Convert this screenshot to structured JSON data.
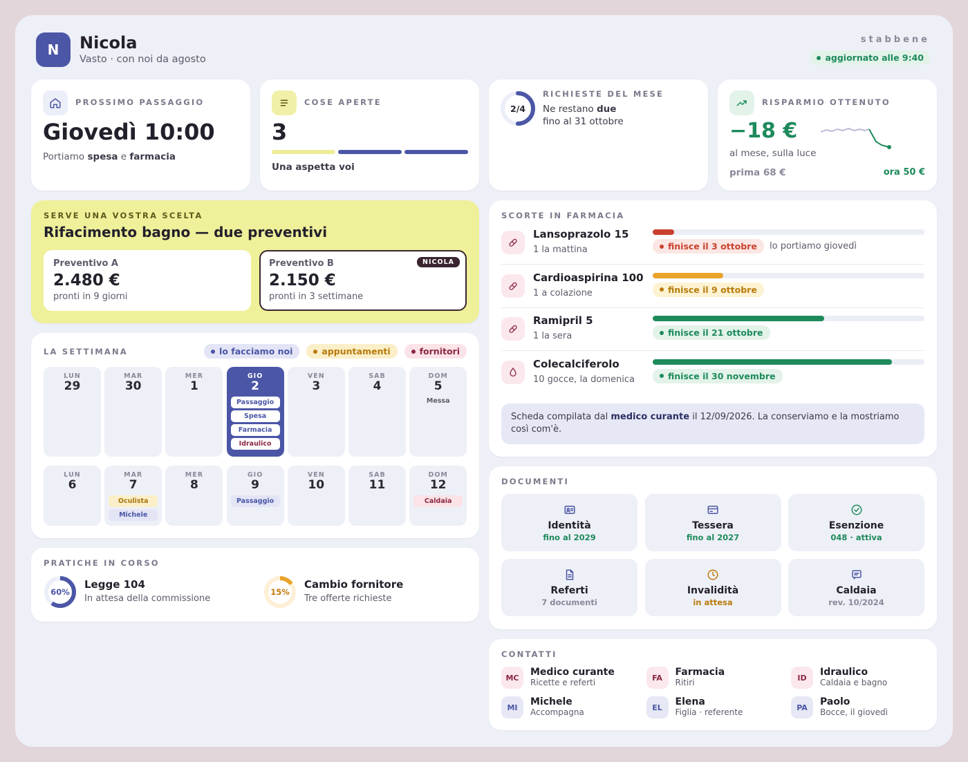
{
  "header": {
    "avatar_letter": "N",
    "name": "Nicola",
    "subtitle": "Vasto · con noi da agosto",
    "brand": "stabbene",
    "updated": "aggiornato alle 9:40"
  },
  "next_visit": {
    "label": "PROSSIMO PASSAGGIO",
    "time": "Giovedì 10:00",
    "desc_pre": "Portiamo ",
    "desc_b1": "spesa",
    "desc_mid": " e ",
    "desc_b2": "farmacia"
  },
  "open_items": {
    "label": "COSE APERTE",
    "count": "3",
    "note": "Una aspetta voi"
  },
  "requests": {
    "label": "RICHIESTE DEL MESE",
    "ring": "2/4",
    "ring_fraction": 0.5,
    "line1_pre": "Ne restano ",
    "line1_b": "due",
    "line2": "fino al 31 ottobre"
  },
  "savings": {
    "label": "RISPARMIO OTTENUTO",
    "value": "−18 €",
    "desc": "al mese, sulla luce",
    "before": "prima 68 €",
    "now": "ora 50 €"
  },
  "decision": {
    "label": "SERVE UNA VOSTRA SCELTA",
    "title": "Rifacimento bagno — due preventivi",
    "option_a": {
      "name": "Preventivo A",
      "price": "2.480 €",
      "time": "pronti in 9 giorni"
    },
    "option_b": {
      "name": "Preventivo B",
      "price": "2.150 €",
      "time": "pronti in 3 settimane",
      "badge": "NICOLA"
    }
  },
  "week": {
    "label": "LA SETTIMANA",
    "legend": [
      "lo facciamo noi",
      "appuntamenti",
      "fornitori"
    ],
    "row1": [
      {
        "dn": "LUN",
        "dd": "29",
        "events": []
      },
      {
        "dn": "MAR",
        "dd": "30",
        "events": []
      },
      {
        "dn": "MER",
        "dd": "1",
        "events": []
      },
      {
        "dn": "GIO",
        "dd": "2",
        "events": [
          "Passaggio",
          "Spesa",
          "Farmacia",
          "Idraulico"
        ]
      },
      {
        "dn": "VEN",
        "dd": "3",
        "events": []
      },
      {
        "dn": "SAB",
        "dd": "4",
        "events": []
      },
      {
        "dn": "DOM",
        "dd": "5",
        "events": [
          "Messa"
        ]
      }
    ],
    "row2": [
      {
        "dn": "LUN",
        "dd": "6",
        "events": []
      },
      {
        "dn": "MAR",
        "dd": "7",
        "events": [
          "Oculista",
          "Michele"
        ]
      },
      {
        "dn": "MER",
        "dd": "8",
        "events": []
      },
      {
        "dn": "GIO",
        "dd": "9",
        "events": [
          "Passaggio"
        ]
      },
      {
        "dn": "VEN",
        "dd": "10",
        "events": []
      },
      {
        "dn": "SAB",
        "dd": "11",
        "events": []
      },
      {
        "dn": "DOM",
        "dd": "12",
        "events": [
          "Caldaia"
        ]
      }
    ]
  },
  "practices": {
    "label": "PRATICHE IN CORSO",
    "items": [
      {
        "pct": "60%",
        "fraction": 0.6,
        "title": "Legge 104",
        "sub": "In attesa della commissione",
        "color": "#4b56a6"
      },
      {
        "pct": "15%",
        "fraction": 0.15,
        "title": "Cambio fornitore",
        "sub": "Tre offerte richieste",
        "color": "#e9a22a"
      }
    ]
  },
  "pharmacy": {
    "label": "SCORTE IN FARMACIA",
    "meds": [
      {
        "name": "Lansoprazolo 15",
        "dose": "1 la mattina",
        "level": 0.08,
        "tag": "finisce il 3 ottobre",
        "note": "lo portiamo giovedì",
        "color": "#c9412d"
      },
      {
        "name": "Cardioaspirina 100",
        "dose": "1 a colazione",
        "level": 0.26,
        "tag": "finisce il 9 ottobre",
        "note": "",
        "color": "#e9a22a"
      },
      {
        "name": "Ramipril 5",
        "dose": "1 la sera",
        "level": 0.63,
        "tag": "finisce il 21 ottobre",
        "note": "",
        "color": "#1e8a5c"
      },
      {
        "name": "Colecalciferolo",
        "dose": "10 gocce, la domenica",
        "level": 0.88,
        "tag": "finisce il 30 novembre",
        "note": "",
        "color": "#1e8a5c"
      }
    ],
    "footer_pre": "Scheda compilata dal ",
    "footer_b": "medico curante",
    "footer_post": " il 12/09/2026. La conserviamo e la mostriamo così com'è."
  },
  "documents": {
    "label": "DOCUMENTI",
    "items": [
      {
        "title": "Identità",
        "sub": "fino al 2029",
        "icon": "id-card-icon"
      },
      {
        "title": "Tessera",
        "sub": "fino al 2027",
        "icon": "card-icon"
      },
      {
        "title": "Esenzione",
        "sub": "048 · attiva",
        "icon": "check-circle-icon"
      },
      {
        "title": "Referti",
        "sub": "7 documenti",
        "icon": "file-icon"
      },
      {
        "title": "Invalidità",
        "sub": "in attesa",
        "icon": "clock-icon"
      },
      {
        "title": "Caldaia",
        "sub": "rev. 10/2024",
        "icon": "message-icon"
      }
    ]
  },
  "contacts": {
    "label": "CONTATTI",
    "items": [
      {
        "initials": "MC",
        "name": "Medico curante",
        "sub": "Ricette e referti"
      },
      {
        "initials": "FA",
        "name": "Farmacia",
        "sub": "Ritiri"
      },
      {
        "initials": "ID",
        "name": "Idraulico",
        "sub": "Caldaia e bagno"
      },
      {
        "initials": "MI",
        "name": "Michele",
        "sub": "Accompagna"
      },
      {
        "initials": "EL",
        "name": "Elena",
        "sub": "Figlia · referente"
      },
      {
        "initials": "PA",
        "name": "Paolo",
        "sub": "Bocce, il giovedì"
      }
    ]
  }
}
